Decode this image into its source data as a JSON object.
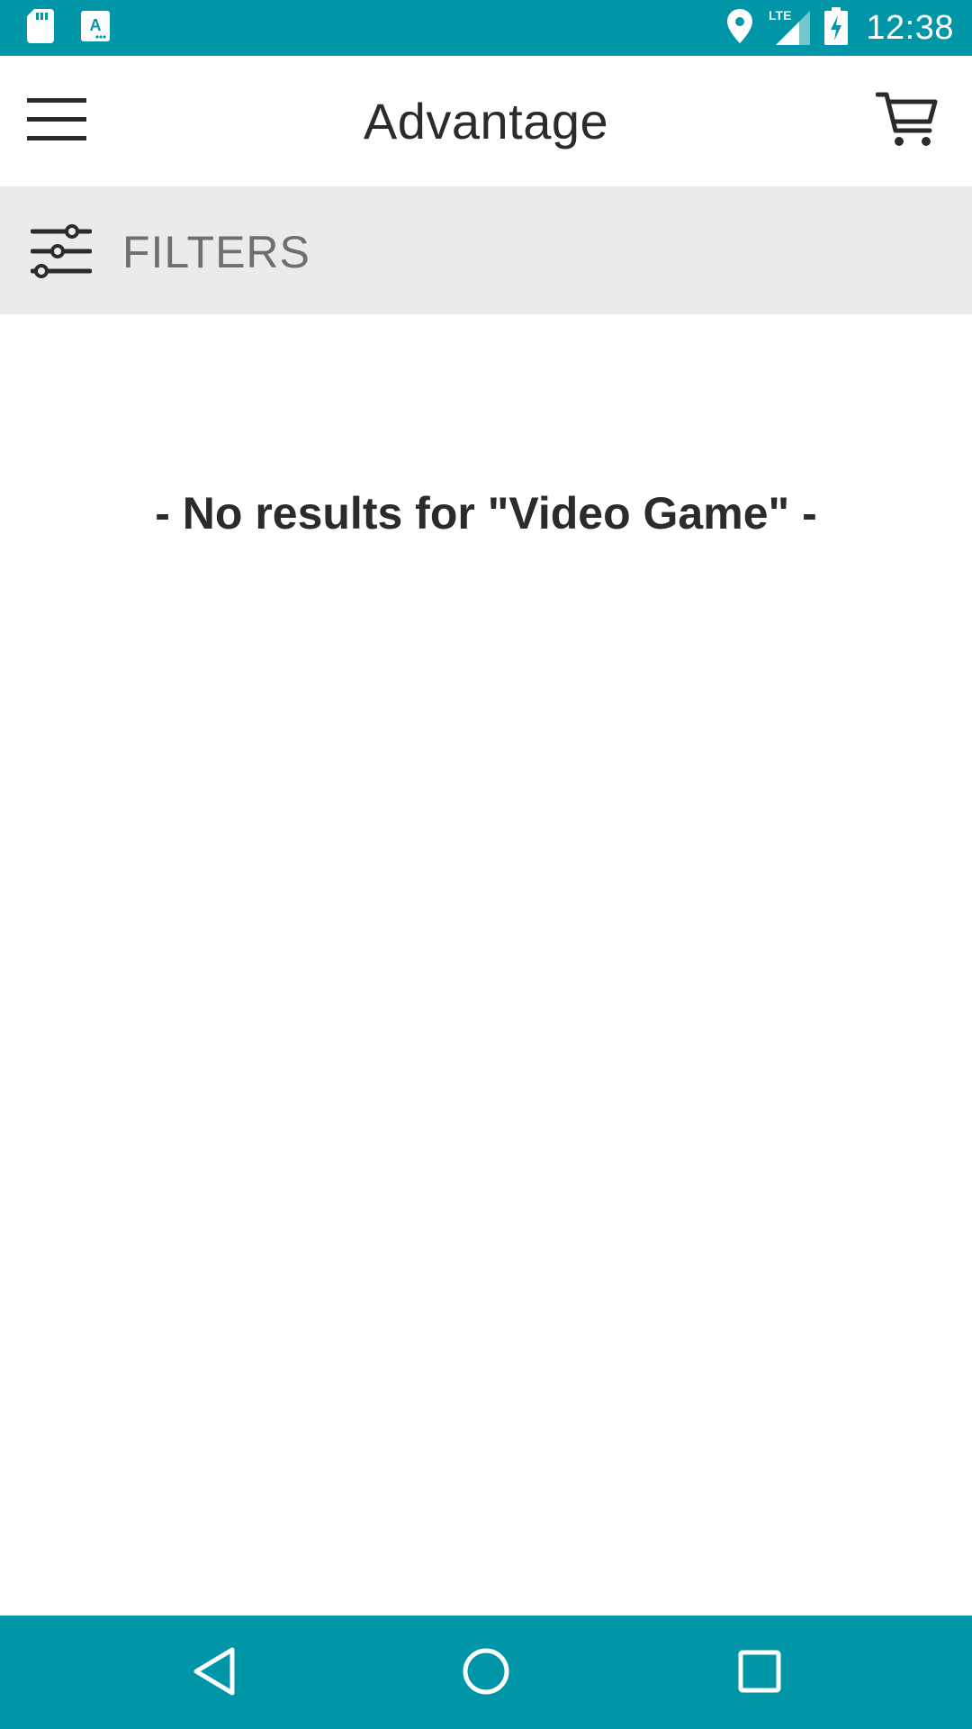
{
  "status_bar": {
    "time": "12:38",
    "network": "LTE",
    "left_icons": [
      "sd-card-icon",
      "text-a-icon"
    ],
    "right_icons": [
      "location-icon",
      "signal-icon",
      "battery-charging-icon"
    ]
  },
  "app_bar": {
    "title": "Advantage",
    "menu_icon": "hamburger-menu-icon",
    "cart_icon": "shopping-cart-icon"
  },
  "filters": {
    "label": "FILTERS",
    "icon": "sliders-icon"
  },
  "results": {
    "message": "- No results for \"Video Game\" -"
  },
  "nav_bar": {
    "icons": [
      "back-icon",
      "home-icon",
      "recents-icon"
    ]
  },
  "colors": {
    "primary": "#0096a7",
    "filters_background": "#ebebeb",
    "text_dark": "#2b2b2b",
    "text_muted": "#6f6f6f"
  }
}
